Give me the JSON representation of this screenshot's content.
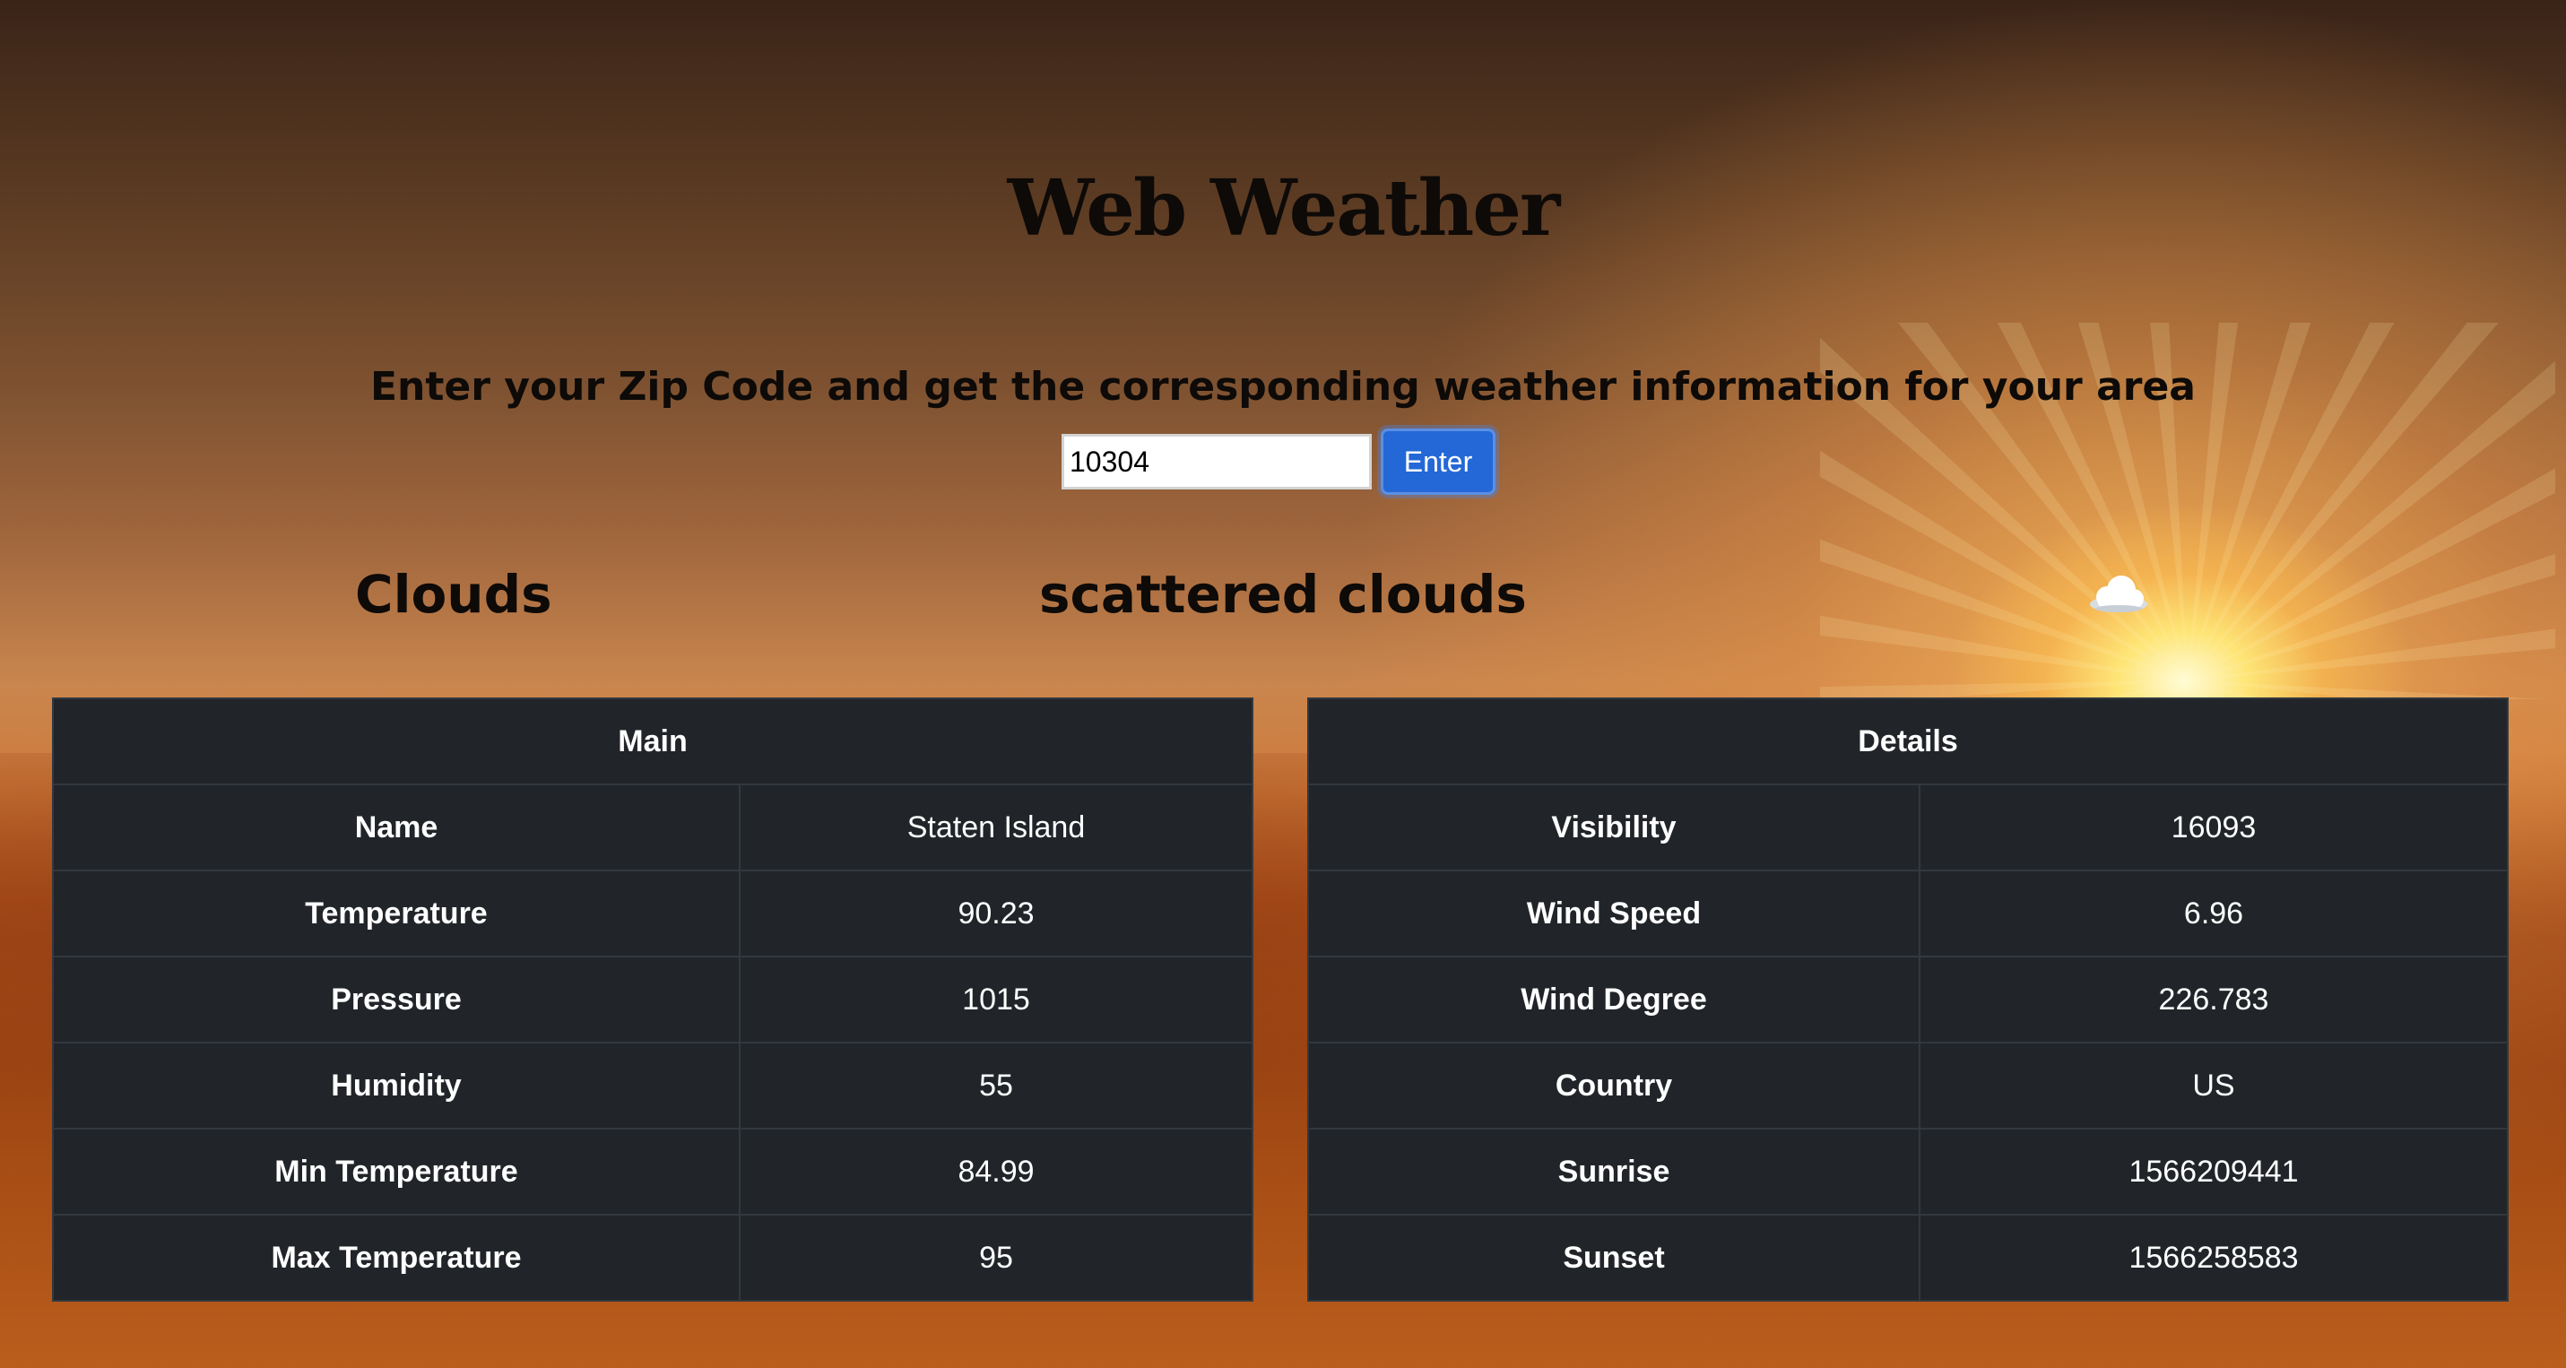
{
  "app": {
    "title": "Web Weather",
    "subtitle": "Enter your Zip Code and get the corresponding weather information for your area"
  },
  "form": {
    "zip_value": "10304",
    "enter_label": "Enter"
  },
  "conditions": {
    "main": "Clouds",
    "description": "scattered clouds",
    "icon": "cloud-icon"
  },
  "main_table": {
    "header": "Main",
    "rows": [
      {
        "label": "Name",
        "value": "Staten Island"
      },
      {
        "label": "Temperature",
        "value": "90.23"
      },
      {
        "label": "Pressure",
        "value": "1015"
      },
      {
        "label": "Humidity",
        "value": "55"
      },
      {
        "label": "Min Temperature",
        "value": "84.99"
      },
      {
        "label": "Max Temperature",
        "value": "95"
      }
    ]
  },
  "details_table": {
    "header": "Details",
    "rows": [
      {
        "label": "Visibility",
        "value": "16093"
      },
      {
        "label": "Wind Speed",
        "value": "6.96"
      },
      {
        "label": "Wind Degree",
        "value": "226.783"
      },
      {
        "label": "Country",
        "value": "US"
      },
      {
        "label": "Sunrise",
        "value": "1566209441"
      },
      {
        "label": "Sunset",
        "value": "1566258583"
      }
    ]
  },
  "colors": {
    "button": "#2368d6",
    "table_bg": "#212529",
    "table_border": "#32383e",
    "heading_text": "#0d0a08"
  }
}
